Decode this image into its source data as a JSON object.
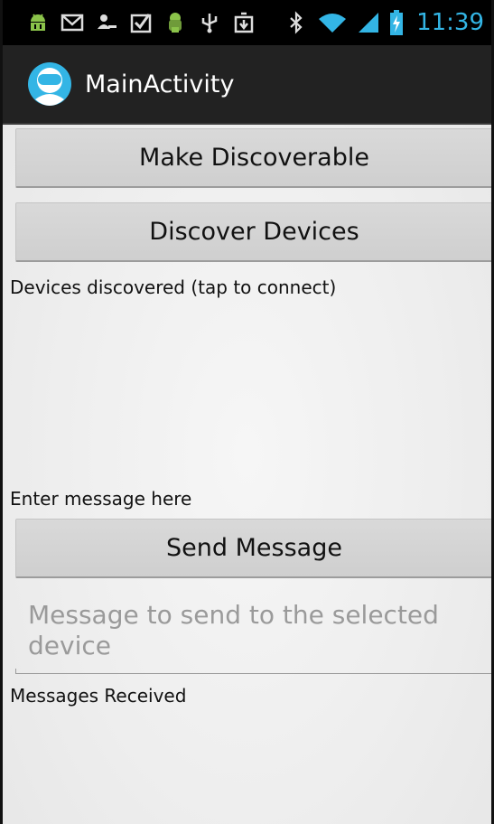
{
  "status_bar": {
    "time": "11:39",
    "left_icons": [
      "android-debug-icon",
      "gmail-icon",
      "user-sync-icon",
      "checkbox-task-icon",
      "android-icon",
      "usb-icon",
      "download-icon"
    ],
    "right_icons": [
      "bluetooth-icon",
      "wifi-icon",
      "signal-icon",
      "battery-charging-icon"
    ],
    "accent_color": "#33b5e5"
  },
  "action_bar": {
    "title": "MainActivity"
  },
  "main": {
    "make_discoverable_label": "Make Discoverable",
    "discover_devices_label": "Discover Devices",
    "devices_discovered_label": "Devices discovered (tap to connect)",
    "enter_message_label": "Enter message here",
    "send_message_label": "Send Message",
    "message_input_placeholder": "Message to send to the selected device",
    "messages_received_label": "Messages Received"
  }
}
